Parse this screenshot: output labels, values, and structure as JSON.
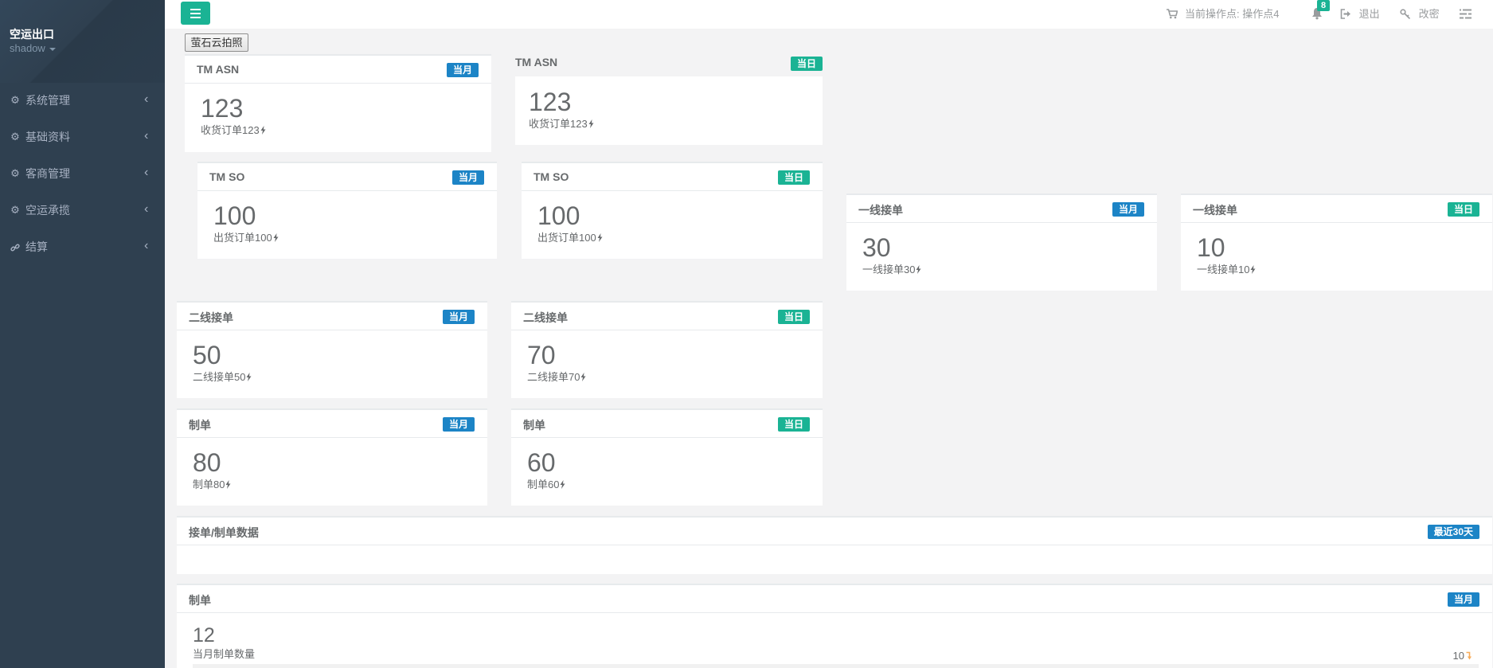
{
  "app": {
    "title": "空运出口",
    "user": "shadow"
  },
  "sidebar": {
    "items": [
      {
        "label": "系统管理",
        "icon": "gear-icon"
      },
      {
        "label": "基础资料",
        "icon": "gear-icon"
      },
      {
        "label": "客商管理",
        "icon": "gear-icon"
      },
      {
        "label": "空运承揽",
        "icon": "gear-icon"
      },
      {
        "label": "结算",
        "icon": "link-icon"
      }
    ]
  },
  "topbar": {
    "operation_point": "当前操作点: 操作点4",
    "notifications": "8",
    "logout": "退出",
    "change_password": "改密"
  },
  "toolbar": {
    "photo_button": "萤石云拍照"
  },
  "colors": {
    "sidebar": "#2f4050",
    "badge_month": "#1c84c6",
    "badge_day": "#1ab394",
    "trend_down": "#f8ac59"
  },
  "cards": [
    {
      "title": "TM ASN",
      "badge": "当月",
      "number": "123",
      "caption": "收货订单123"
    },
    {
      "title": "TM ASN",
      "badge": "当日",
      "number": "123",
      "caption": "收货订单123"
    },
    {
      "title": "TM SO",
      "badge": "当月",
      "number": "100",
      "caption": "出货订单100"
    },
    {
      "title": "TM SO",
      "badge": "当日",
      "number": "100",
      "caption": "出货订单100"
    },
    {
      "title": "一线接单",
      "badge": "当月",
      "number": "30",
      "caption": "一线接单30"
    },
    {
      "title": "一线接单",
      "badge": "当日",
      "number": "10",
      "caption": "一线接单10"
    },
    {
      "title": "二线接单",
      "badge": "当月",
      "number": "50",
      "caption": "二线接单50"
    },
    {
      "title": "二线接单",
      "badge": "当日",
      "number": "70",
      "caption": "二线接单70"
    },
    {
      "title": "制单",
      "badge": "当月",
      "number": "80",
      "caption": "制单80"
    },
    {
      "title": "制单",
      "badge": "当日",
      "number": "60",
      "caption": "制单60"
    }
  ],
  "stats_panel": {
    "title": "接单/制单数据",
    "badge": "最近30天"
  },
  "orders_panel": {
    "title": "制单",
    "badge": "当月",
    "number": "12",
    "caption": "当月制单数量",
    "trend_value": "10"
  }
}
